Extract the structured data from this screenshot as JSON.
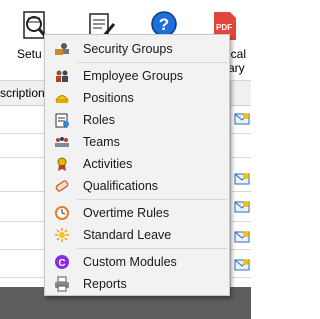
{
  "ribbon": {
    "setup_label": "Setu",
    "right_label_1": "ical",
    "right_label_2": "ary"
  },
  "grid": {
    "header_partial": "scription"
  },
  "menu": {
    "items": [
      {
        "label": "Security Groups",
        "icon": "security-groups-icon"
      },
      {
        "label": "Employee Groups",
        "icon": "employee-groups-icon"
      },
      {
        "label": "Positions",
        "icon": "positions-icon"
      },
      {
        "label": "Roles",
        "icon": "roles-icon"
      },
      {
        "label": "Teams",
        "icon": "teams-icon"
      },
      {
        "label": "Activities",
        "icon": "activities-icon"
      },
      {
        "label": "Qualifications",
        "icon": "qualifications-icon"
      },
      {
        "label": "Overtime Rules",
        "icon": "overtime-rules-icon"
      },
      {
        "label": "Standard Leave",
        "icon": "standard-leave-icon"
      },
      {
        "label": "Custom Modules",
        "icon": "custom-modules-icon"
      },
      {
        "label": "Reports",
        "icon": "reports-icon"
      }
    ]
  },
  "colors": {
    "menu_bg": "#f2f2f2",
    "separator": "#d7d7d7",
    "help_blue": "#1e6fd9",
    "pdf_red": "#e0463b",
    "custom_purple": "#8a2be2"
  }
}
